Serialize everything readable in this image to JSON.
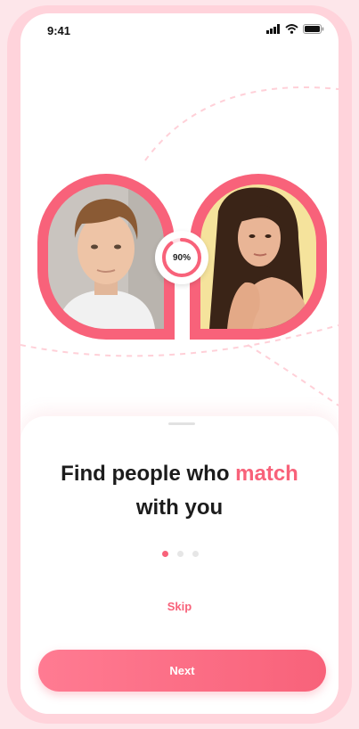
{
  "status_bar": {
    "time": "9:41",
    "icons": [
      "signal-icon",
      "wifi-icon",
      "battery-icon"
    ]
  },
  "match": {
    "percent_label": "90%",
    "percent_value": 0.9
  },
  "profiles": [
    {
      "photo": "young man with curly hair in white t-shirt"
    },
    {
      "photo": "woman with long dark hair, bare shoulder"
    }
  ],
  "onboarding": {
    "headline_part1": "Find people who ",
    "headline_accent": "match",
    "headline_part2": "with you",
    "pages_total": 3,
    "active_page": 1,
    "skip_label": "Skip",
    "next_label": "Next"
  },
  "colors": {
    "accent": "#f8627a",
    "background": "#fde6ea",
    "frame": "#ffd3db"
  }
}
